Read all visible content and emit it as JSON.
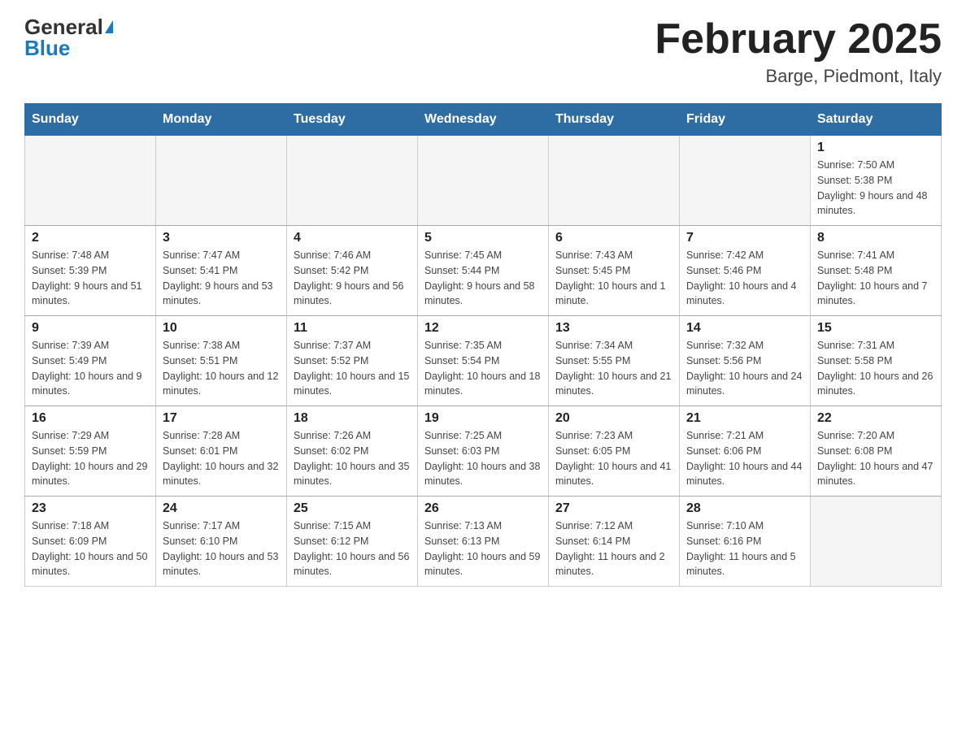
{
  "header": {
    "logo_general": "General",
    "logo_blue": "Blue",
    "month_title": "February 2025",
    "location": "Barge, Piedmont, Italy"
  },
  "days_of_week": [
    "Sunday",
    "Monday",
    "Tuesday",
    "Wednesday",
    "Thursday",
    "Friday",
    "Saturday"
  ],
  "weeks": [
    [
      {
        "day": "",
        "info": "",
        "empty": true
      },
      {
        "day": "",
        "info": "",
        "empty": true
      },
      {
        "day": "",
        "info": "",
        "empty": true
      },
      {
        "day": "",
        "info": "",
        "empty": true
      },
      {
        "day": "",
        "info": "",
        "empty": true
      },
      {
        "day": "",
        "info": "",
        "empty": true
      },
      {
        "day": "1",
        "info": "Sunrise: 7:50 AM\nSunset: 5:38 PM\nDaylight: 9 hours and 48 minutes.",
        "empty": false
      }
    ],
    [
      {
        "day": "2",
        "info": "Sunrise: 7:48 AM\nSunset: 5:39 PM\nDaylight: 9 hours and 51 minutes.",
        "empty": false
      },
      {
        "day": "3",
        "info": "Sunrise: 7:47 AM\nSunset: 5:41 PM\nDaylight: 9 hours and 53 minutes.",
        "empty": false
      },
      {
        "day": "4",
        "info": "Sunrise: 7:46 AM\nSunset: 5:42 PM\nDaylight: 9 hours and 56 minutes.",
        "empty": false
      },
      {
        "day": "5",
        "info": "Sunrise: 7:45 AM\nSunset: 5:44 PM\nDaylight: 9 hours and 58 minutes.",
        "empty": false
      },
      {
        "day": "6",
        "info": "Sunrise: 7:43 AM\nSunset: 5:45 PM\nDaylight: 10 hours and 1 minute.",
        "empty": false
      },
      {
        "day": "7",
        "info": "Sunrise: 7:42 AM\nSunset: 5:46 PM\nDaylight: 10 hours and 4 minutes.",
        "empty": false
      },
      {
        "day": "8",
        "info": "Sunrise: 7:41 AM\nSunset: 5:48 PM\nDaylight: 10 hours and 7 minutes.",
        "empty": false
      }
    ],
    [
      {
        "day": "9",
        "info": "Sunrise: 7:39 AM\nSunset: 5:49 PM\nDaylight: 10 hours and 9 minutes.",
        "empty": false
      },
      {
        "day": "10",
        "info": "Sunrise: 7:38 AM\nSunset: 5:51 PM\nDaylight: 10 hours and 12 minutes.",
        "empty": false
      },
      {
        "day": "11",
        "info": "Sunrise: 7:37 AM\nSunset: 5:52 PM\nDaylight: 10 hours and 15 minutes.",
        "empty": false
      },
      {
        "day": "12",
        "info": "Sunrise: 7:35 AM\nSunset: 5:54 PM\nDaylight: 10 hours and 18 minutes.",
        "empty": false
      },
      {
        "day": "13",
        "info": "Sunrise: 7:34 AM\nSunset: 5:55 PM\nDaylight: 10 hours and 21 minutes.",
        "empty": false
      },
      {
        "day": "14",
        "info": "Sunrise: 7:32 AM\nSunset: 5:56 PM\nDaylight: 10 hours and 24 minutes.",
        "empty": false
      },
      {
        "day": "15",
        "info": "Sunrise: 7:31 AM\nSunset: 5:58 PM\nDaylight: 10 hours and 26 minutes.",
        "empty": false
      }
    ],
    [
      {
        "day": "16",
        "info": "Sunrise: 7:29 AM\nSunset: 5:59 PM\nDaylight: 10 hours and 29 minutes.",
        "empty": false
      },
      {
        "day": "17",
        "info": "Sunrise: 7:28 AM\nSunset: 6:01 PM\nDaylight: 10 hours and 32 minutes.",
        "empty": false
      },
      {
        "day": "18",
        "info": "Sunrise: 7:26 AM\nSunset: 6:02 PM\nDaylight: 10 hours and 35 minutes.",
        "empty": false
      },
      {
        "day": "19",
        "info": "Sunrise: 7:25 AM\nSunset: 6:03 PM\nDaylight: 10 hours and 38 minutes.",
        "empty": false
      },
      {
        "day": "20",
        "info": "Sunrise: 7:23 AM\nSunset: 6:05 PM\nDaylight: 10 hours and 41 minutes.",
        "empty": false
      },
      {
        "day": "21",
        "info": "Sunrise: 7:21 AM\nSunset: 6:06 PM\nDaylight: 10 hours and 44 minutes.",
        "empty": false
      },
      {
        "day": "22",
        "info": "Sunrise: 7:20 AM\nSunset: 6:08 PM\nDaylight: 10 hours and 47 minutes.",
        "empty": false
      }
    ],
    [
      {
        "day": "23",
        "info": "Sunrise: 7:18 AM\nSunset: 6:09 PM\nDaylight: 10 hours and 50 minutes.",
        "empty": false
      },
      {
        "day": "24",
        "info": "Sunrise: 7:17 AM\nSunset: 6:10 PM\nDaylight: 10 hours and 53 minutes.",
        "empty": false
      },
      {
        "day": "25",
        "info": "Sunrise: 7:15 AM\nSunset: 6:12 PM\nDaylight: 10 hours and 56 minutes.",
        "empty": false
      },
      {
        "day": "26",
        "info": "Sunrise: 7:13 AM\nSunset: 6:13 PM\nDaylight: 10 hours and 59 minutes.",
        "empty": false
      },
      {
        "day": "27",
        "info": "Sunrise: 7:12 AM\nSunset: 6:14 PM\nDaylight: 11 hours and 2 minutes.",
        "empty": false
      },
      {
        "day": "28",
        "info": "Sunrise: 7:10 AM\nSunset: 6:16 PM\nDaylight: 11 hours and 5 minutes.",
        "empty": false
      },
      {
        "day": "",
        "info": "",
        "empty": true
      }
    ]
  ]
}
